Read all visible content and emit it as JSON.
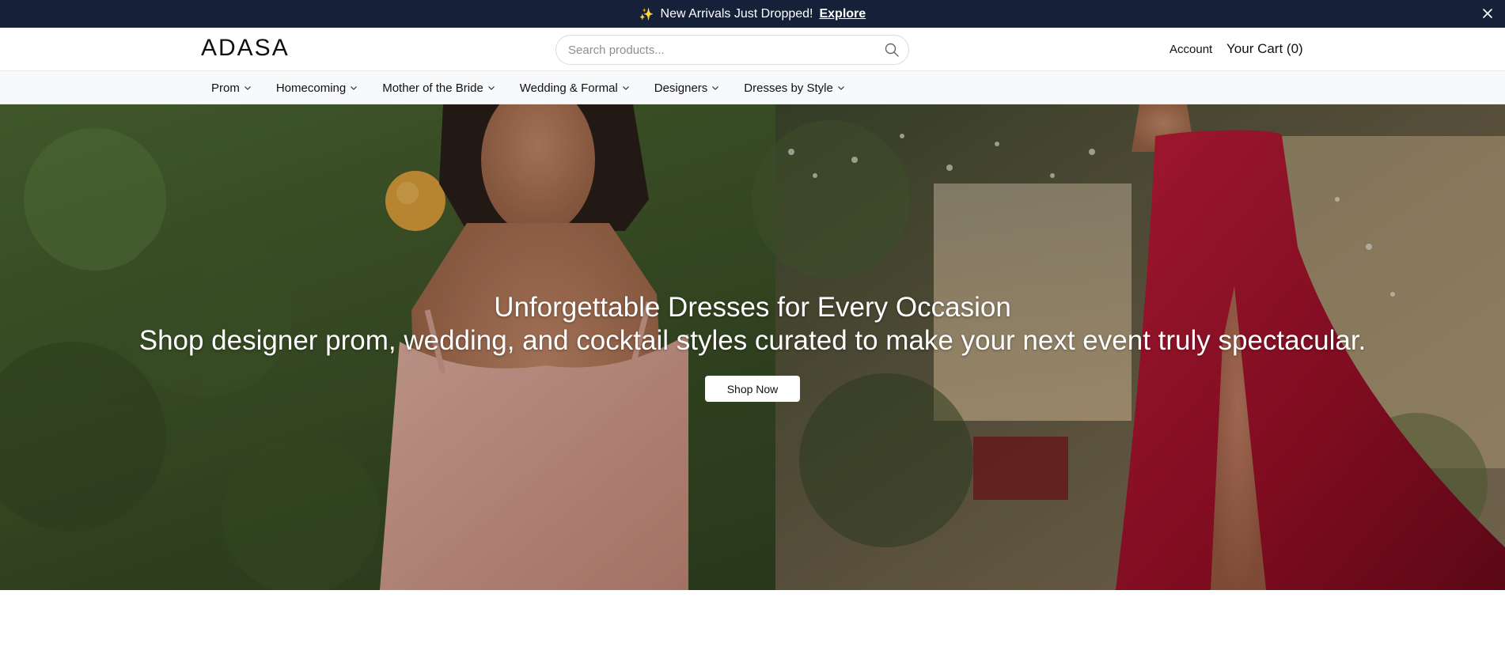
{
  "announcement": {
    "sparkle": "✨",
    "text": "New Arrivals Just Dropped!",
    "link": "Explore"
  },
  "header": {
    "logo": "ADASA",
    "search_placeholder": "Search products...",
    "account": "Account",
    "cart": "Your Cart (0)"
  },
  "nav": {
    "items": [
      {
        "label": "Prom"
      },
      {
        "label": "Homecoming"
      },
      {
        "label": "Mother of the Bride"
      },
      {
        "label": "Wedding & Formal"
      },
      {
        "label": "Designers"
      },
      {
        "label": "Dresses by Style"
      }
    ]
  },
  "hero": {
    "title": "Unforgettable Dresses for Every Occasion",
    "subtitle": "Shop designer prom, wedding, and cocktail styles curated to make your next event truly spectacular.",
    "cta": "Shop Now"
  },
  "colors": {
    "announce_bg": "#162038",
    "nav_bg": "#f8f9fb",
    "accent_dress_pink": "#d9a191",
    "accent_dress_red": "#a3122a"
  }
}
